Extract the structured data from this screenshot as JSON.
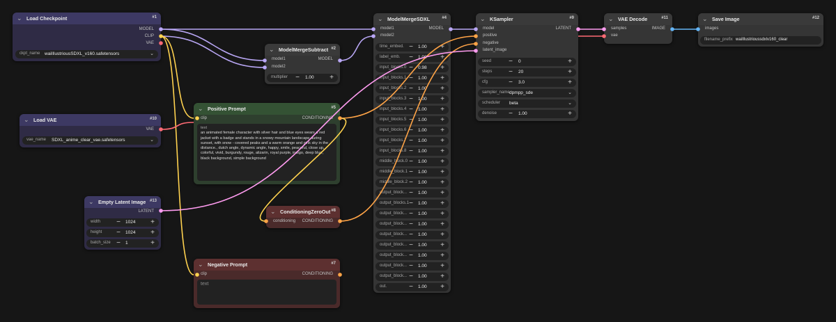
{
  "colors": {
    "background": "#161616",
    "node_body": "#353535",
    "load_node": "#2f2b45",
    "load_header": "#3d3963",
    "positive_body": "#2e3f2e",
    "positive_header": "#345234",
    "negative_body": "#4a2a2a",
    "negative_header": "#5d3030",
    "model_link": "#b9a7f5",
    "clip_link": "#ffd24f",
    "vae_link": "#ff6b75",
    "conditioning_link": "#ffa447",
    "latent_link": "#ff9cf0",
    "image_link": "#64b5f6"
  },
  "nodes": {
    "checkpoint": {
      "title": "Load Checkpoint",
      "id": "#1",
      "outputs": [
        "MODEL",
        "CLIP",
        "VAE"
      ],
      "widget_label": "ckpt_name",
      "widget_value": "waiIllustriousSDXL_v160.safetensors"
    },
    "vae_loader": {
      "title": "Load VAE",
      "id": "#10",
      "outputs": [
        "VAE"
      ],
      "widget_label": "vae_name",
      "widget_value": "SDXL_anime_clear_vae.safetensors"
    },
    "latent": {
      "title": "Empty Latent Image",
      "id": "#13",
      "outputs": [
        "LATENT"
      ],
      "widgets": [
        {
          "label": "width",
          "value": "1024"
        },
        {
          "label": "height",
          "value": "1024"
        },
        {
          "label": "batch_size",
          "value": "1"
        }
      ]
    },
    "subtract": {
      "title": "ModelMergeSubtract",
      "id": "#2",
      "inputs": [
        "model1",
        "model2"
      ],
      "outputs": [
        "MODEL"
      ],
      "widget_label": "multiplier",
      "widget_value": "1.00"
    },
    "positive": {
      "title": "Positive Prompt",
      "id": "#5",
      "inputs": [
        "clip"
      ],
      "outputs": [
        "CONDITIONING"
      ],
      "text_label": "text",
      "text": "an animated female character with silver hair and blue eyes wears a red jacket with a badge and stands in a snowy mountain landscape during sunset, with snow - covered peaks and a warm orange and pink sky in the distance.,  dutch angle, dynamic angle, happy, smile, peaceful, close up, colorful, vivid, burgundy, rouge, alizarin, royal purple, indigo, deep blue, black background, simple background"
    },
    "zero_out": {
      "title": "ConditioningZeroOut",
      "id": "#8",
      "inputs": [
        "conditioning"
      ],
      "outputs": [
        "CONDITIONING"
      ]
    },
    "negative": {
      "title": "Negative Prompt",
      "id": "#7",
      "inputs": [
        "clip"
      ],
      "outputs": [
        "CONDITIONING"
      ],
      "text_placeholder": "text"
    },
    "merge": {
      "title": "ModelMergeSDXL",
      "id": "#4",
      "inputs": [
        "model1",
        "model2"
      ],
      "outputs": [
        "MODEL"
      ],
      "widgets": [
        {
          "label": "time_embed.",
          "value": "1.00"
        },
        {
          "label": "label_emb.",
          "value": "1.00"
        },
        {
          "label": "input_blocks.0",
          "value": "0.98"
        },
        {
          "label": "input_blocks.1",
          "value": "1.00"
        },
        {
          "label": "input_blocks.2",
          "value": "1.00"
        },
        {
          "label": "input_blocks.3",
          "value": "1.00"
        },
        {
          "label": "input_blocks.4",
          "value": "1.00"
        },
        {
          "label": "input_blocks.5",
          "value": "1.00"
        },
        {
          "label": "input_blocks.6",
          "value": "1.00"
        },
        {
          "label": "input_blocks.7",
          "value": "1.00"
        },
        {
          "label": "input_blocks.8",
          "value": "1.00"
        },
        {
          "label": "middle_block.0",
          "value": "1.00"
        },
        {
          "label": "middle_block.1",
          "value": "1.00"
        },
        {
          "label": "middle_block.2",
          "value": "1.00"
        },
        {
          "label": "output_block...",
          "value": "1.00"
        },
        {
          "label": "output_blocks.1",
          "value": "1.00"
        },
        {
          "label": "output_block...",
          "value": "1.00"
        },
        {
          "label": "output_block...",
          "value": "1.00"
        },
        {
          "label": "output_block...",
          "value": "1.00"
        },
        {
          "label": "output_block...",
          "value": "1.00"
        },
        {
          "label": "output_block...",
          "value": "1.00"
        },
        {
          "label": "output_block...",
          "value": "1.00"
        },
        {
          "label": "output_block...",
          "value": "1.00"
        },
        {
          "label": "out.",
          "value": "1.00"
        }
      ]
    },
    "ksampler": {
      "title": "KSampler",
      "id": "#9",
      "inputs": [
        "model",
        "positive",
        "negative",
        "latent_image"
      ],
      "outputs": [
        "LATENT"
      ],
      "widgets": [
        {
          "label": "seed",
          "value": "0",
          "kind": "number"
        },
        {
          "label": "steps",
          "value": "20",
          "kind": "number"
        },
        {
          "label": "cfg",
          "value": "3.0",
          "kind": "number"
        },
        {
          "label": "sampler_name",
          "value": "dpmpp_sde",
          "kind": "combo"
        },
        {
          "label": "scheduler",
          "value": "beta",
          "kind": "combo"
        },
        {
          "label": "denoise",
          "value": "1.00",
          "kind": "number"
        }
      ]
    },
    "vae_decode": {
      "title": "VAE Decode",
      "id": "#11",
      "inputs": [
        "samples",
        "vae"
      ],
      "outputs": [
        "IMAGE"
      ]
    },
    "save_image": {
      "title": "Save Image",
      "id": "#12",
      "inputs": [
        "images"
      ],
      "widget_label": "filename_prefix",
      "widget_value": "waiIllustrioussdxlv160_clear"
    }
  }
}
